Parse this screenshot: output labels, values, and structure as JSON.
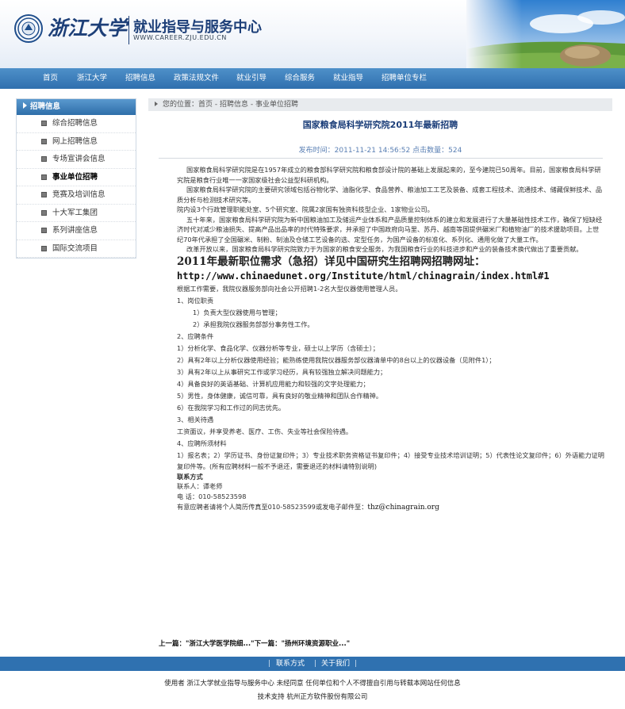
{
  "header": {
    "university_name": "浙江大学",
    "center_name": "就业指导与服务中心",
    "url_text": "WWW.CAREER.ZJU.EDU.CN"
  },
  "nav": {
    "items": [
      {
        "label": "首页"
      },
      {
        "label": "浙江大学"
      },
      {
        "label": "招聘信息"
      },
      {
        "label": "政策法规文件"
      },
      {
        "label": "就业引导"
      },
      {
        "label": "综合服务"
      },
      {
        "label": "就业指导"
      },
      {
        "label": "招聘单位专栏"
      }
    ]
  },
  "sidebar": {
    "title": "招聘信息",
    "items": [
      {
        "label": "综合招聘信息",
        "active": false
      },
      {
        "label": "网上招聘信息",
        "active": false
      },
      {
        "label": "专场宣讲会信息",
        "active": false
      },
      {
        "label": "事业单位招聘",
        "active": true
      },
      {
        "label": "竞赛及培训信息",
        "active": false
      },
      {
        "label": "十大军工集团",
        "active": false
      },
      {
        "label": "系列讲座信息",
        "active": false
      },
      {
        "label": "国际交流项目",
        "active": false
      }
    ]
  },
  "breadcrumb": {
    "text": "您的位置：首页 - 招聘信息 - 事业单位招聘"
  },
  "article": {
    "title": "国家粮食局科学研究院2011年最新招聘",
    "meta": "发布时间：2011-11-21 14:56:52  点击数量：524",
    "intro": [
      "国家粮食局科学研究院是在1957年成立的粮食部科学研究院和粮食部设计院的基础上发展起来的，至今建院已50周年。目前，国家粮食局科学研究院是粮食行业唯一一家国家级社会公益型科研机构。",
      "国家粮食局科学研究院的主要研究领域包括谷物化学、油脂化学、食品营养、粮油加工工艺及装备、成套工程技术、流通技术、储藏保鲜技术、品质分析与检测技术研究等。",
      "院内设3个行政管理职能处室、5个研究室、院属2家国有独资科技型企业、1家物业公司。",
      "五十年来，国家粮食局科学研究院为新中国粮油加工及储运产业体系和产品质量控制体系的建立和发展进行了大量基础性技术工作，确保了短缺经济时代对减少粮油损失、提高产品出品率的时代特殊要求，并承担了中国政府向马里、苏丹、越南等国提供碾米厂和植物油厂的技术援助项目。上世纪70年代承担了全国碾米、制粉、制油及仓储工艺设备的选、定型任务，为国产设备的标准化、系列化、通用化做了大量工作。",
      "改革开放以来，国家粮食局科学研究院致力于为国家的粮食安全服务，为我国粮食行业的科技进步和产业的装备技术换代做出了重要贡献。"
    ],
    "headline": "2011年最新职位需求（急招）详见中国研究生招聘网招聘网址：",
    "link_url": "http://www.chinaedunet.org/Institute/html/chinagrain/index.html#1",
    "summary": "根据工作需要，我院仪器服务部向社会公开招聘1-2名大型仪器使用管理人员。",
    "section1": "1、岗位职责",
    "duty1": "1）负责大型仪器使用与管理；",
    "duty2": "2）承担我院仪器服务部部分事务性工作。",
    "section2": "2、应聘条件",
    "req1": "1）分析化学、食品化学、仪器分析等专业，硕士以上学历（含硕士）；",
    "req2": "2）具有2年以上分析仪器使用经验；能熟练使用我院仪器服务部仪器清单中的8台以上的仪器设备（见附件1）；",
    "req3": "3）具有2年以上从事研究工作或学习经历，具有较强独立解决问题能力；",
    "req4": "4）具备良好的英语基础、计算机应用能力和较强的文字处理能力；",
    "req5": "5）男性，身体健康，诚信可靠，具有良好的敬业精神和团队合作精神。",
    "req6": "6）在我院学习和工作过的同志优先。",
    "section3": "3、相关待遇",
    "benefit": "工资面议，并享受养老、医疗、工伤、失业等社会保险待遇。",
    "section4": "4、应聘所须材料",
    "materials": "1）报名表；2）学历证书、身份证复印件；3）专业技术职务资格证书复印件；4）接受专业技术培训证明；5）代表性论文复印件；6）外语能力证明复印件等。(所有应聘材料一般不予退还，需要退还的材料请特别说明)",
    "contact_title": "联系方式",
    "contact_person": "联系人：谭老师",
    "contact_phone": "电  话：010-58523598",
    "contact_note": "有意应聘者请将个人简历传真至010-58523599或发电子邮件至：",
    "contact_email": "thz@chinagrain.org"
  },
  "prevnext": {
    "prev_label": "上一篇：",
    "prev_title": "\"浙江大学医学院细...\"",
    "next_label": "下一篇：",
    "next_title": "\"扬州环境资源职业...\""
  },
  "footer": {
    "sep": "|",
    "contact_link": "联系方式",
    "about_link": "关于我们",
    "copyright": "使用者 浙江大学就业指导与服务中心  未经同意  任何单位和个人不得擅自引用与转载本网站任何信息",
    "support": "技术支持 杭州正方软件股份有限公司"
  },
  "colors": {
    "nav_bg": "#2f6fae",
    "brand_blue": "#1d3f78",
    "meta_blue": "#5b80b4"
  }
}
